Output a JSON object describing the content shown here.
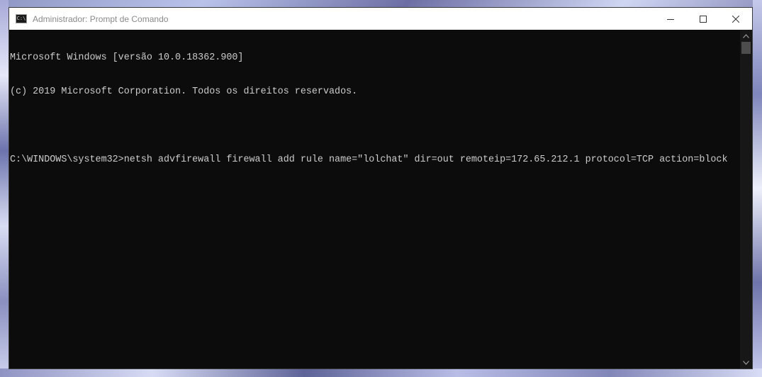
{
  "window": {
    "title": "Administrador: Prompt de Comando",
    "icon": "cmd-icon",
    "icon_glyph": "C:\\",
    "controls": {
      "minimize": "minimize-icon",
      "maximize": "maximize-icon",
      "close": "close-icon"
    }
  },
  "console": {
    "lines": [
      "Microsoft Windows [versão 10.0.18362.900]",
      "(c) 2019 Microsoft Corporation. Todos os direitos reservados.",
      "",
      "C:\\WINDOWS\\system32>netsh advfirewall firewall add rule name=\"lolchat\" dir=out remoteip=172.65.212.1 protocol=TCP action=block"
    ]
  },
  "colors": {
    "console_bg": "#0c0c0c",
    "console_fg": "#cccccc",
    "titlebar_bg": "#ffffff",
    "title_text": "#8a8a8a"
  }
}
